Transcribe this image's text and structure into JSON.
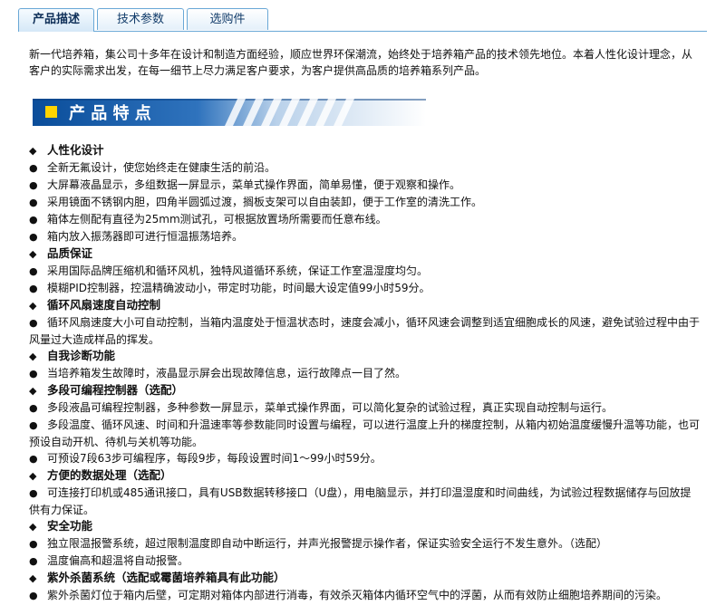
{
  "tabs": [
    {
      "label": "产品描述",
      "active": true
    },
    {
      "label": "技术参数",
      "active": false
    },
    {
      "label": "选购件",
      "active": false
    }
  ],
  "intro": "新一代培养箱，集公司十多年在设计和制造方面经验，顺应世界环保潮流，始终处于培养箱产品的技术领先地位。本着人性化设计理念，从客户的实际需求出发，在每一细节上尽力满足客户要求，为客户提供高品质的培养箱系列产品。",
  "banner": {
    "title": "产 品 特 点"
  },
  "colors": {
    "tab_border": "#6aa8d6",
    "banner_blue": "#0a4d9a",
    "banner_yellow": "#ffd400"
  },
  "feature_sections": [
    {
      "heading": "人性化设计",
      "items": [
        "全新无氟设计，使您始终走在健康生活的前沿。",
        "大屏幕液晶显示，多组数据一屏显示，菜单式操作界面，简单易懂，便于观察和操作。",
        "采用镜面不锈钢内胆，四角半圆弧过渡，搁板支架可以自由装卸，便于工作室的清洗工作。",
        "箱体左侧配有直径为25mm测试孔，可根据放置场所需要而任意布线。",
        "箱内放入振荡器即可进行恒温振荡培养。"
      ]
    },
    {
      "heading": "品质保证",
      "items": [
        "采用国际品牌压缩机和循环风机，独特风道循环系统，保证工作室温湿度均匀。",
        "模糊PID控制器，控温精确波动小，带定时功能，时间最大设定值99小时59分。"
      ]
    },
    {
      "heading": "循环风扇速度自动控制",
      "items": [
        "循环风扇速度大小可自动控制，当箱内温度处于恒温状态时，速度会减小，循环风速会调整到适宜细胞成长的风速，避免试验过程中由于风量过大造成样品的挥发。"
      ]
    },
    {
      "heading": "自我诊断功能",
      "items": [
        "当培养箱发生故障时，液晶显示屏会出现故障信息，运行故障点一目了然。"
      ]
    },
    {
      "heading": "多段可编程控制器（选配）",
      "items": [
        "多段液晶可编程控制器，多种参数一屏显示，菜单式操作界面，可以简化复杂的试验过程，真正实现自动控制与运行。",
        "多段温度、循环风速、时间和升温速率等参数能同时设置与编程，可以进行温度上升的梯度控制，从箱内初始温度缓慢升温等功能，也可预设自动开机、待机与关机等功能。",
        "可预设7段63步可编程序，每段9步，每段设置时间1～99小时59分。"
      ]
    },
    {
      "heading": "方便的数据处理（选配）",
      "items": [
        "可连接打印机或485通讯接口，具有USB数据转移接口（U盘），用电脑显示，并打印温湿度和时间曲线，为试验过程数据储存与回放提供有力保证。"
      ]
    },
    {
      "heading": "安全功能",
      "items": [
        "独立限温报警系统，超过限制温度即自动中断运行，并声光报警提示操作者，保证实验安全运行不发生意外。（选配）",
        "温度偏高和超温将自动报警。"
      ]
    },
    {
      "heading": "紫外杀菌系统（选配或霉菌培养箱具有此功能）",
      "items": [
        "紫外杀菌灯位于箱内后壁，可定期对箱体内部进行消毒，有效杀灭箱体内循环空气中的浮菌，从而有效防止细胞培养期间的污染。"
      ]
    }
  ]
}
